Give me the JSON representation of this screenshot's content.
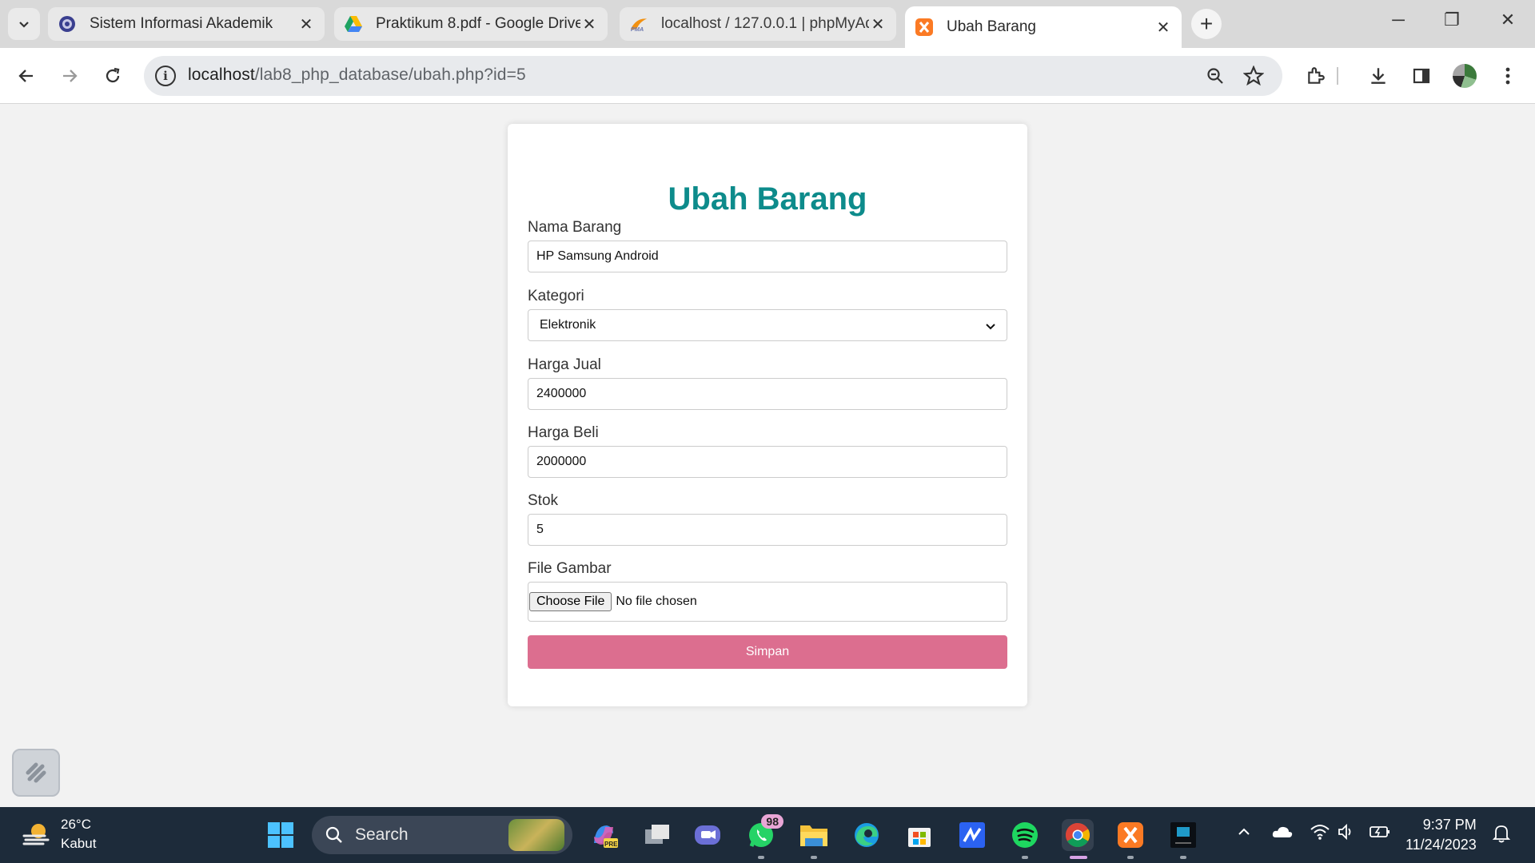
{
  "browser": {
    "tabs": [
      {
        "title": "Sistem Informasi Akademik",
        "icon": "university-icon"
      },
      {
        "title": "Praktikum 8.pdf - Google Drive",
        "icon": "google-drive-icon"
      },
      {
        "title": "localhost / 127.0.0.1 | phpMyAd",
        "icon": "phpmyadmin-icon"
      },
      {
        "title": "Ubah Barang",
        "icon": "xampp-icon",
        "active": true
      }
    ],
    "url_host": "localhost",
    "url_path": "/lab8_php_database/ubah.php?id=5"
  },
  "page": {
    "title": "Ubah Barang",
    "fields": {
      "nama_label": "Nama Barang",
      "nama_value": "HP Samsung Android",
      "kategori_label": "Kategori",
      "kategori_value": "Elektronik",
      "harga_jual_label": "Harga Jual",
      "harga_jual_value": "2400000",
      "harga_beli_label": "Harga Beli",
      "harga_beli_value": "2000000",
      "stok_label": "Stok",
      "stok_value": "5",
      "gambar_label": "File Gambar",
      "choose_file": "Choose File",
      "no_file": "No file chosen"
    },
    "submit_label": "Simpan"
  },
  "taskbar": {
    "weather_temp": "26°C",
    "weather_desc": "Kabut",
    "search_label": "Search",
    "whatsapp_badge": "98",
    "time": "9:37 PM",
    "date": "11/24/2023"
  },
  "colors": {
    "title": "#0d8b8b",
    "button": "#dc6e8f",
    "taskbar": "#1d2b3a"
  }
}
